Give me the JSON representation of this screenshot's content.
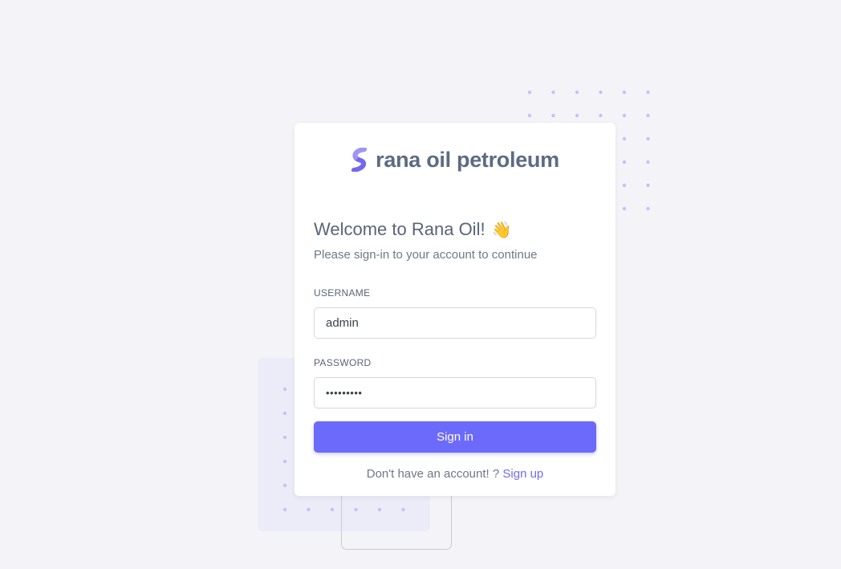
{
  "brand": {
    "name": "rana oil petroleum",
    "logo_icon": "s-logo-icon",
    "logo_color": "#7367f0"
  },
  "welcome": {
    "title": "Welcome to Rana Oil!",
    "emoji": "👋",
    "subtitle": "Please sign-in to your account to continue"
  },
  "form": {
    "username_label": "USERNAME",
    "username_value": "admin",
    "password_label": "PASSWORD",
    "password_value": "•••••••••",
    "submit_label": "Sign in"
  },
  "footer": {
    "prompt": "Don't have an account! ? ",
    "link_label": "Sign up"
  },
  "colors": {
    "primary": "#6c6afa",
    "background": "#f4f4f8",
    "dots": "#c5c1fb"
  }
}
